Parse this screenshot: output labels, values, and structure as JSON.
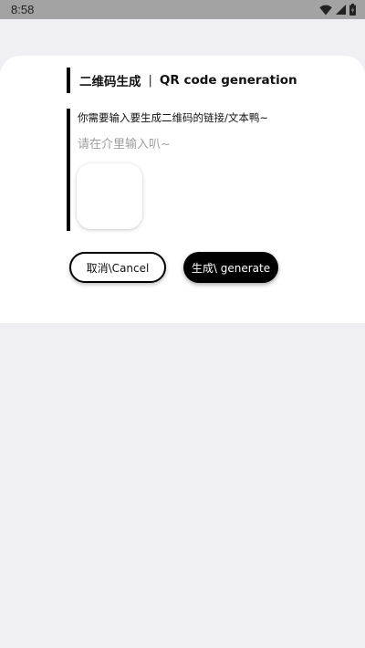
{
  "status_bar": {
    "time": "8:58",
    "icons": [
      "wifi-icon",
      "signal-icon",
      "battery-icon"
    ]
  },
  "dialog": {
    "title_cn": "二维码生成",
    "title_separator": "|",
    "title_en": "QR code generation",
    "prompt": "你需要输入要生成二维码的链接/文本鸭~",
    "input": {
      "value": "",
      "placeholder": "请在介里输入叭~"
    },
    "buttons": {
      "cancel_label": "取消\\Cancel",
      "generate_label": "生成\\ generate"
    }
  },
  "colors": {
    "background": "#efeff4",
    "status_bar": "#a3a3a3",
    "card": "#ffffff",
    "accent": "#000000",
    "placeholder": "#9e9e9e"
  }
}
